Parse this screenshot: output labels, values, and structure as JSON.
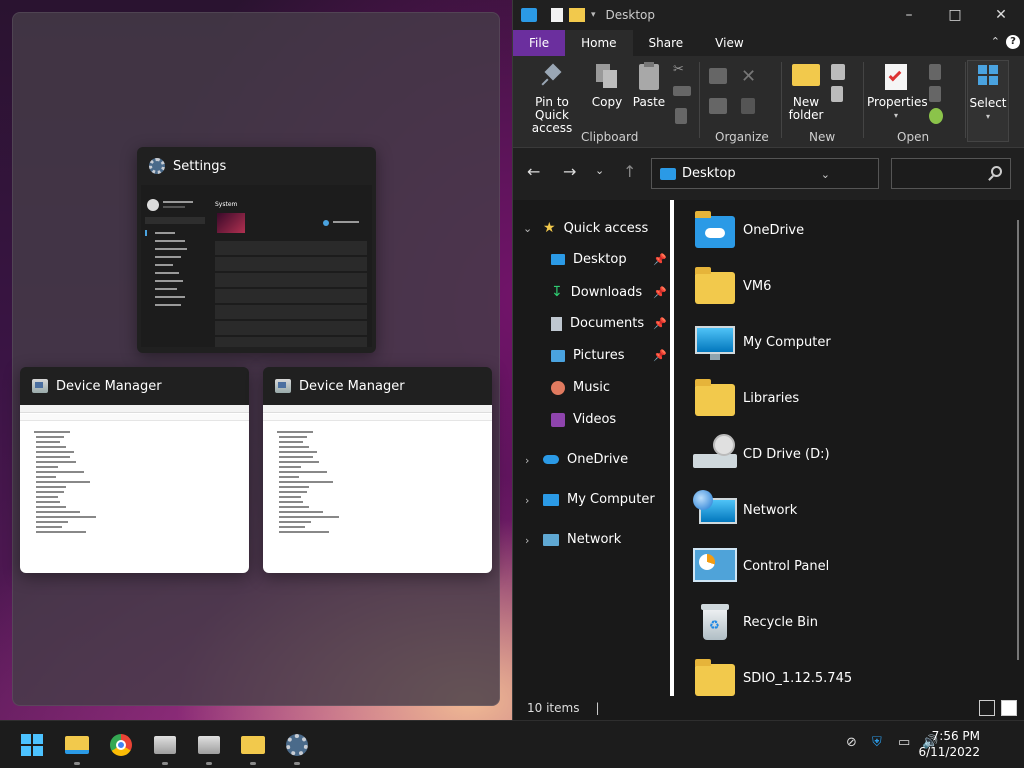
{
  "snap_assist": {
    "windows": [
      {
        "title": "Settings",
        "icon": "gear-icon"
      },
      {
        "title": "Device Manager",
        "icon": "device-manager-icon"
      },
      {
        "title": "Device Manager",
        "icon": "device-manager-icon"
      }
    ]
  },
  "explorer": {
    "title": "Desktop",
    "tabs": [
      {
        "label": "File"
      },
      {
        "label": "Home"
      },
      {
        "label": "Share"
      },
      {
        "label": "View"
      }
    ],
    "ribbon": {
      "pin_to_quick_access": "Pin to Quick access",
      "copy": "Copy",
      "paste": "Paste",
      "new_folder": "New folder",
      "properties": "Properties",
      "select": "Select",
      "groups": {
        "clipboard": "Clipboard",
        "organize": "Organize",
        "new": "New",
        "open": "Open"
      }
    },
    "address": {
      "location": "Desktop",
      "search_placeholder": ""
    },
    "nav_pane": {
      "quick_access": "Quick access",
      "items": [
        {
          "label": "Desktop",
          "icon": "desktop-icon",
          "pinned": true
        },
        {
          "label": "Downloads",
          "icon": "downloads-icon",
          "pinned": true
        },
        {
          "label": "Documents",
          "icon": "documents-icon",
          "pinned": true
        },
        {
          "label": "Pictures",
          "icon": "pictures-icon",
          "pinned": true
        },
        {
          "label": "Music",
          "icon": "music-icon",
          "pinned": false
        },
        {
          "label": "Videos",
          "icon": "videos-icon",
          "pinned": false
        }
      ],
      "onedrive": "OneDrive",
      "my_computer": "My Computer",
      "network": "Network"
    },
    "files": [
      {
        "name": "OneDrive",
        "icon": "onedrive-folder-icon"
      },
      {
        "name": "VM6",
        "icon": "folder-icon"
      },
      {
        "name": "My Computer",
        "icon": "computer-icon"
      },
      {
        "name": "Libraries",
        "icon": "libraries-icon"
      },
      {
        "name": "CD Drive (D:)",
        "icon": "cd-drive-icon"
      },
      {
        "name": "Network",
        "icon": "network-icon"
      },
      {
        "name": "Control Panel",
        "icon": "control-panel-icon"
      },
      {
        "name": "Recycle Bin",
        "icon": "recycle-bin-icon"
      },
      {
        "name": "SDIO_1.12.5.745",
        "icon": "folder-icon"
      }
    ],
    "status": {
      "item_count": "10 items"
    }
  },
  "taskbar": {
    "apps": [
      {
        "name": "start",
        "icon": "windows-start-icon"
      },
      {
        "name": "file-explorer",
        "icon": "file-explorer-icon"
      },
      {
        "name": "chrome",
        "icon": "chrome-icon"
      },
      {
        "name": "device-manager-1",
        "icon": "device-manager-icon"
      },
      {
        "name": "device-manager-2",
        "icon": "device-manager-icon"
      },
      {
        "name": "task-folder",
        "icon": "task-folder-icon"
      },
      {
        "name": "settings",
        "icon": "gear-icon"
      }
    ],
    "clock": {
      "time": "7:56 PM",
      "date": "6/11/2022"
    }
  },
  "colors": {
    "file_tab": "#6b2f9e",
    "folder": "#f2c94c",
    "accent_blue": "#2b9ae6"
  }
}
